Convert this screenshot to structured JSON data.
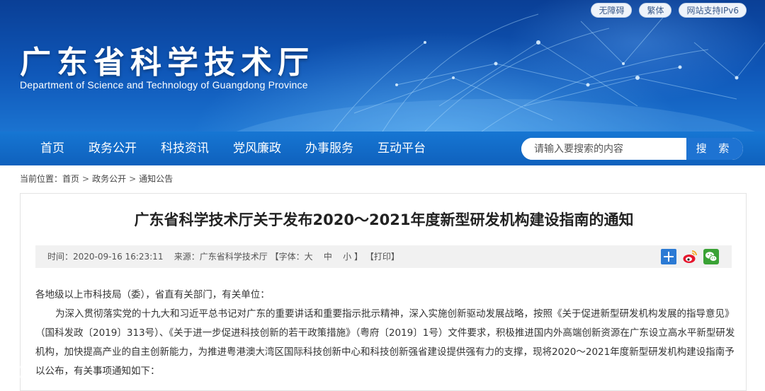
{
  "header": {
    "title": "广东省科学技术厅",
    "subtitle": "Department of Science and Technology of Guangdong Province",
    "top_links": [
      "无障碍",
      "繁体",
      "网站支持IPv6"
    ]
  },
  "nav": {
    "items": [
      "首页",
      "政务公开",
      "科技资讯",
      "党风廉政",
      "办事服务",
      "互动平台"
    ],
    "search_placeholder": "请输入要搜索的内容",
    "search_button": "搜 索"
  },
  "breadcrumb": {
    "label": "当前位置：",
    "items": [
      "首页",
      "政务公开",
      "通知公告"
    ],
    "separator": ">"
  },
  "article": {
    "title": "广东省科学技术厅关于发布2020～2021年度新型研发机构建设指南的通知",
    "meta": {
      "time": "时间：2020-09-16 16:23:11",
      "source": "来源：广东省科学技术厅",
      "font_label": "【字体：",
      "font_large": "大",
      "font_medium": "中",
      "font_small": "小",
      "font_close": "】",
      "print": "【打印】"
    },
    "share_icons": [
      "plus-share-icon",
      "weibo-icon",
      "wechat-icon"
    ],
    "salutation": "各地级以上市科技局（委），省直有关部门，有关单位：",
    "paragraph1": "为深入贯彻落实党的十九大和习近平总书记对广东的重要讲话和重要指示批示精神，深入实施创新驱动发展战略，按照《关于促进新型研发机构发展的指导意见》（国科发政〔2019〕313号）、《关于进一步促进科技创新的若干政策措施》（粤府〔2019〕1号）文件要求，积极推进国内外高端创新资源在广东设立高水平新型研发机构，加快提高产业的自主创新能力，为推进粤港澳大湾区国际科技创新中心和科技创新强省建设提供强有力的支撑，现将2020～2021年度新型研发机构建设指南予以公布，有关事项通知如下："
  },
  "colors": {
    "banner": "#0f57b8",
    "nav": "#1676d3",
    "search_button": "#1e73d2",
    "share_plus": "#2b7ad4",
    "weibo": "#e6162d",
    "wechat": "#3aa235"
  }
}
